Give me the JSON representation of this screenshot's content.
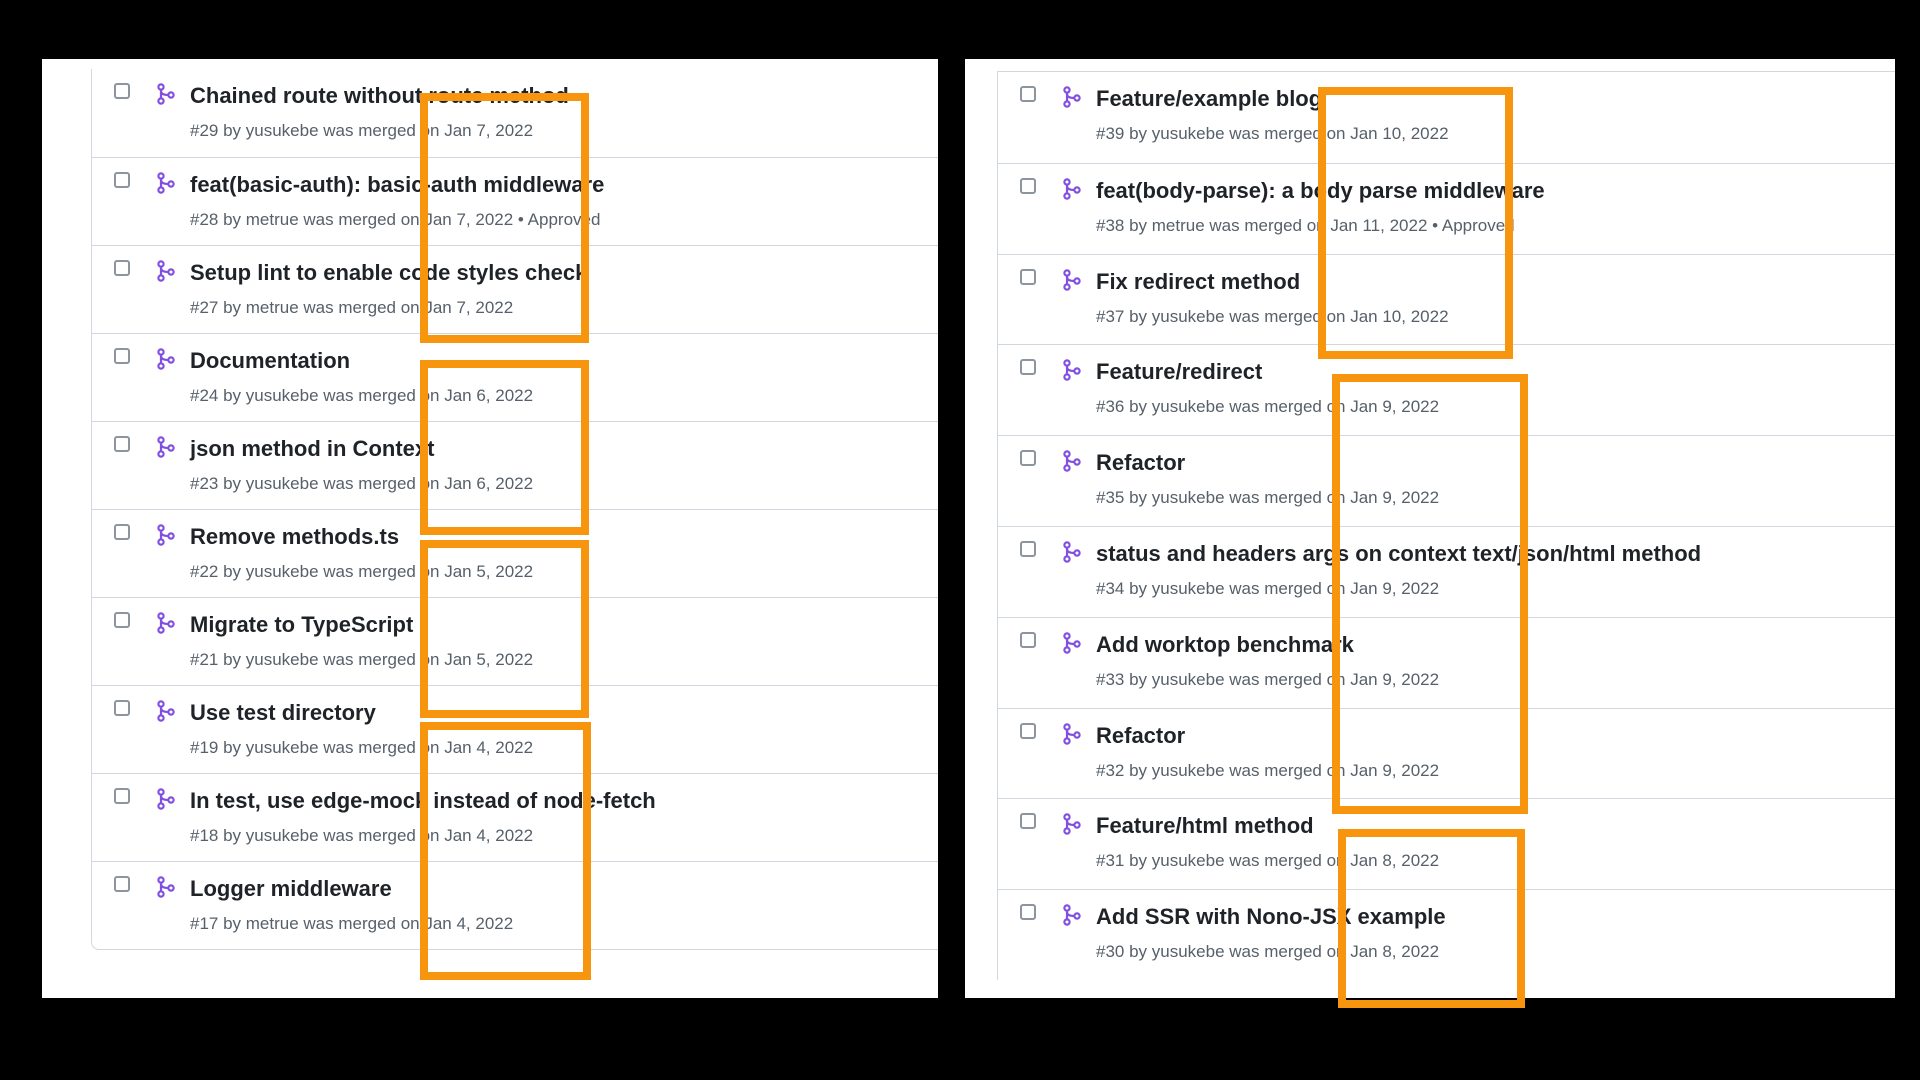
{
  "left": {
    "items": [
      {
        "title": "Chained route without route method",
        "meta": "#29 by yusukebe was merged on Jan 7, 2022"
      },
      {
        "title": "feat(basic-auth): basic-auth middleware",
        "meta": "#28 by metrue was merged on Jan 7, 2022 • Approved"
      },
      {
        "title": "Setup lint to enable code styles check",
        "meta": "#27 by metrue was merged on Jan 7, 2022"
      },
      {
        "title": "Documentation",
        "meta": "#24 by yusukebe was merged on Jan 6, 2022"
      },
      {
        "title": "json method in Context",
        "meta": "#23 by yusukebe was merged on Jan 6, 2022"
      },
      {
        "title": "Remove methods.ts",
        "meta": "#22 by yusukebe was merged on Jan 5, 2022"
      },
      {
        "title": "Migrate to TypeScript",
        "meta": "#21 by yusukebe was merged on Jan 5, 2022"
      },
      {
        "title": "Use test directory",
        "meta": "#19 by yusukebe was merged on Jan 4, 2022"
      },
      {
        "title": "In test, use edge-mock instead of node-fetch",
        "meta": "#18 by yusukebe was merged on Jan 4, 2022"
      },
      {
        "title": "Logger middleware",
        "meta": "#17 by metrue was merged on Jan 4, 2022"
      }
    ]
  },
  "right": {
    "items": [
      {
        "title": "Feature/example blog",
        "meta": "#39 by yusukebe was merged on Jan 10, 2022"
      },
      {
        "title": "feat(body-parse): a body parse middleware",
        "meta": "#38 by metrue was merged on Jan 11, 2022 • Approved"
      },
      {
        "title": "Fix redirect method",
        "meta": "#37 by yusukebe was merged on Jan 10, 2022"
      },
      {
        "title": "Feature/redirect",
        "meta": "#36 by yusukebe was merged on Jan 9, 2022"
      },
      {
        "title": "Refactor",
        "meta": "#35 by yusukebe was merged on Jan 9, 2022"
      },
      {
        "title": "status and headers args on context text/json/html method",
        "meta": "#34 by yusukebe was merged on Jan 9, 2022"
      },
      {
        "title": "Add worktop benchmark",
        "meta": "#33 by yusukebe was merged on Jan 9, 2022"
      },
      {
        "title": "Refactor",
        "meta": "#32 by yusukebe was merged on Jan 9, 2022"
      },
      {
        "title": "Feature/html method",
        "meta": "#31 by yusukebe was merged on Jan 8, 2022"
      },
      {
        "title": "Add SSR with Nono-JSX example",
        "meta": "#30 by yusukebe was merged on Jan 8, 2022"
      }
    ]
  },
  "icons": {
    "merged": "git-merge-icon",
    "checkbox": "checkbox-icon"
  },
  "colors": {
    "highlight": "#f7950f",
    "merged_icon": "#8250df",
    "title_text": "#1f2328",
    "meta_text": "#57606a",
    "border": "#d0d7de"
  }
}
